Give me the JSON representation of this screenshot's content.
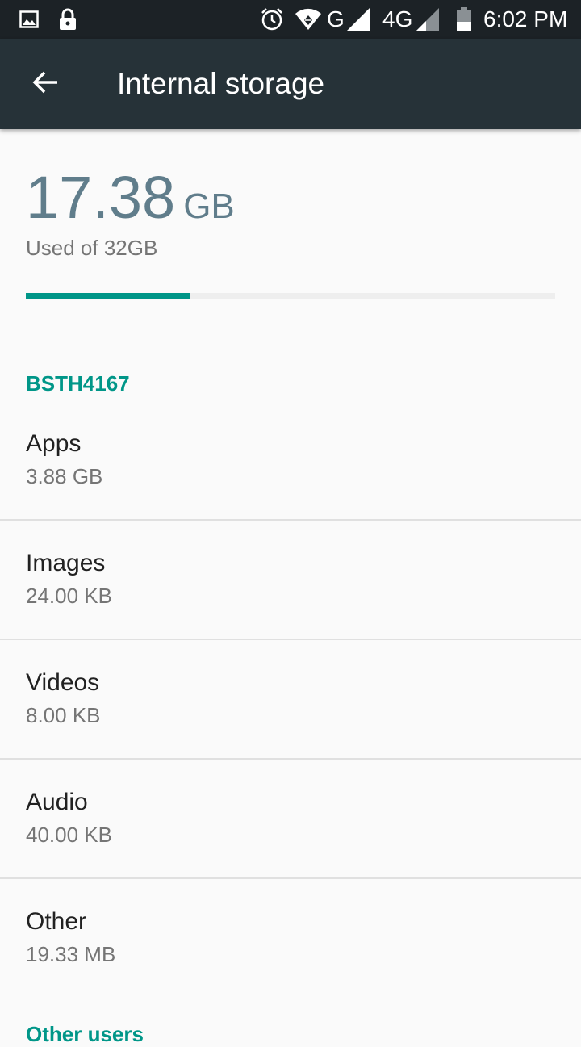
{
  "status_bar": {
    "time": "6:02 PM",
    "network_label_1": "G",
    "network_label_2": "4G",
    "icons": [
      "image-icon",
      "lock-icon",
      "alarm-icon",
      "wifi-icon",
      "signal-icon",
      "signal-icon",
      "battery-icon"
    ]
  },
  "toolbar": {
    "title": "Internal storage",
    "back_icon": "arrow-back-icon"
  },
  "summary": {
    "used_value": "17.38",
    "used_unit": "GB",
    "caption": "Used of 32GB",
    "used_fraction": 0.31
  },
  "section": {
    "header": "BSTH4167"
  },
  "items": [
    {
      "title": "Apps",
      "summary": "3.88 GB"
    },
    {
      "title": "Images",
      "summary": "24.00 KB"
    },
    {
      "title": "Videos",
      "summary": "8.00 KB"
    },
    {
      "title": "Audio",
      "summary": "40.00 KB"
    },
    {
      "title": "Other",
      "summary": "19.33 MB"
    }
  ],
  "section2": {
    "header": "Other users"
  },
  "colors": {
    "accent": "#009688",
    "toolbar": "#263238",
    "status_bar": "#1c2226",
    "summary_text": "#607d8b"
  }
}
